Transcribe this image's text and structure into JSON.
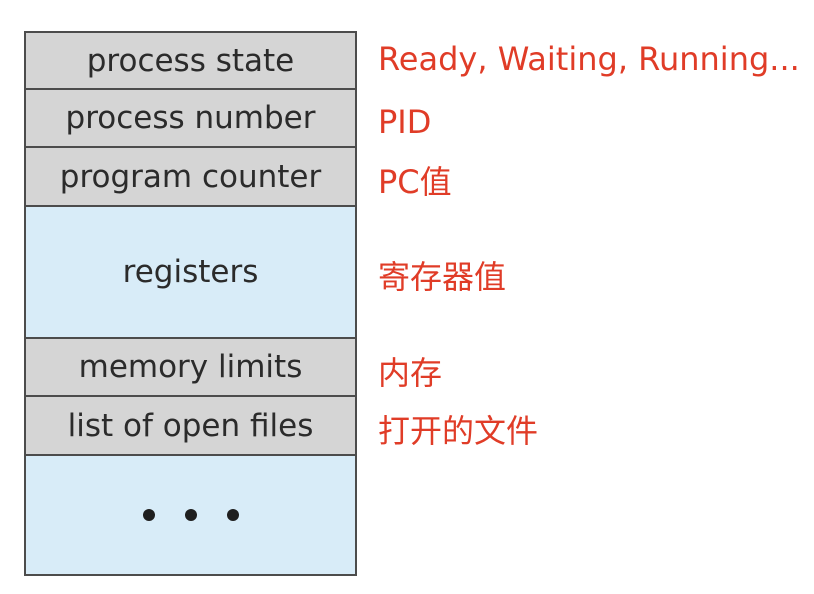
{
  "diagram": {
    "rows": [
      {
        "label": "process state",
        "fill": "gray"
      },
      {
        "label": "process number",
        "fill": "gray"
      },
      {
        "label": "program counter",
        "fill": "gray"
      },
      {
        "label": "registers",
        "fill": "blue"
      },
      {
        "label": "memory limits",
        "fill": "gray"
      },
      {
        "label": "list of open files",
        "fill": "gray"
      },
      {
        "label": "",
        "fill": "blue",
        "glyph": "ellipsis-dots"
      }
    ],
    "annotations": [
      "Ready, Waiting, Running...",
      "PID",
      "PC值",
      "寄存器值",
      "内存",
      "打开的文件"
    ]
  },
  "colors": {
    "row_gray": "#d5d5d5",
    "row_blue": "#d8ecf8",
    "border": "#4c4c4c",
    "annotation_text": "#e03c27",
    "row_text": "#2b2b2b"
  }
}
